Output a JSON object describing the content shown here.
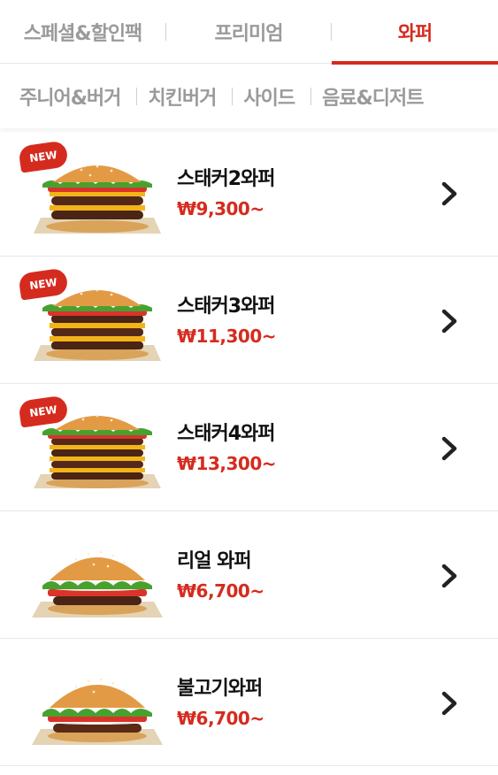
{
  "top_tabs": [
    {
      "label": "스페셜&할인팩",
      "active": false
    },
    {
      "label": "프리미엄",
      "active": false
    },
    {
      "label": "와퍼",
      "active": true
    }
  ],
  "sub_tabs": [
    "주니어&버거",
    "치킨버거",
    "사이드",
    "음료&디저트"
  ],
  "items": [
    {
      "name": "스태커2와퍼",
      "price": "₩9,300~",
      "badge": "NEW",
      "icon": "stacker-burger-2-image"
    },
    {
      "name": "스태커3와퍼",
      "price": "₩11,300~",
      "badge": "NEW",
      "icon": "stacker-burger-3-image"
    },
    {
      "name": "스태커4와퍼",
      "price": "₩13,300~",
      "badge": "NEW",
      "icon": "stacker-burger-4-image"
    },
    {
      "name": "리얼 와퍼",
      "price": "₩6,700~",
      "badge": "",
      "icon": "real-whopper-image"
    },
    {
      "name": "불고기와퍼",
      "price": "₩6,700~",
      "badge": "",
      "icon": "bulgogi-whopper-image"
    }
  ],
  "colors": {
    "accent": "#d52b1e",
    "inactive": "#9a9a9a"
  }
}
